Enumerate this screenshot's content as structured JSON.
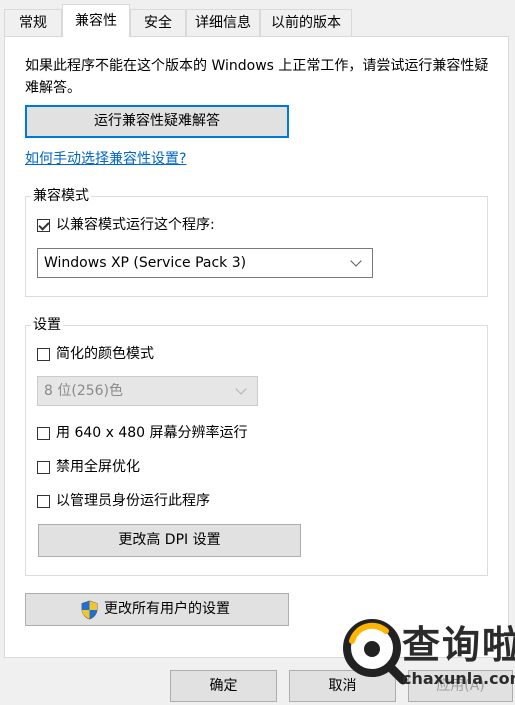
{
  "tabs": [
    {
      "label": "常规"
    },
    {
      "label": "兼容性"
    },
    {
      "label": "安全"
    },
    {
      "label": "详细信息"
    },
    {
      "label": "以前的版本"
    }
  ],
  "description": "如果此程序不能在这个版本的 Windows 上正常工作，请尝试运行兼容性疑难解答。",
  "troubleshoot_button": "运行兼容性疑难解答",
  "manual_link": "如何手动选择兼容性设置?",
  "compat_mode": {
    "group_label": "兼容模式",
    "checkbox_label": "以兼容模式运行这个程序:",
    "checked": true,
    "selected_os": "Windows XP (Service Pack 3)"
  },
  "settings": {
    "group_label": "设置",
    "reduced_color": {
      "label": "简化的颜色模式",
      "checked": false
    },
    "color_select": "8 位(256)色",
    "res_640": {
      "label": "用 640 x 480 屏幕分辨率运行",
      "checked": false
    },
    "fullscreen_opt": {
      "label": "禁用全屏优化",
      "checked": false
    },
    "run_admin": {
      "label": "以管理员身份运行此程序",
      "checked": false
    },
    "dpi_button": "更改高 DPI 设置"
  },
  "all_users_button": "更改所有用户的设置",
  "footer": {
    "ok": "确定",
    "cancel": "取消",
    "apply": "应用(A)"
  },
  "watermark": {
    "brand_cn": "查询啦",
    "brand_url": "chaxunla.com"
  },
  "colors": {
    "accent": "#0078d7",
    "link": "#0066cc",
    "watermark": "#2b2b2b"
  },
  "icons": {
    "uac_shield": "uac-shield-icon"
  }
}
